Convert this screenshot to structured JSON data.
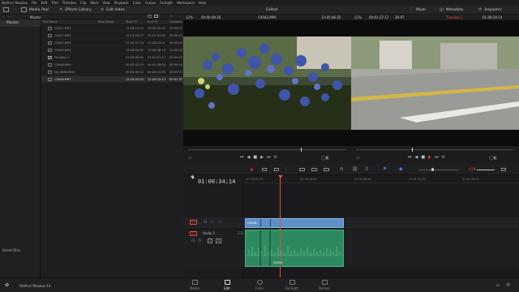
{
  "menu": [
    "DaVinci Resolve",
    "File",
    "Edit",
    "Trim",
    "Timeline",
    "Clip",
    "Mark",
    "View",
    "Playback",
    "Color",
    "Fusion",
    "Fairlight",
    "Workspace",
    "Help"
  ],
  "toolbar": {
    "media_pool": "Media Pool",
    "effects_library": "Effects Library",
    "edit_index": "Edit Index",
    "project_name": "Edited",
    "mixer": "Mixer",
    "metadata": "Metadata",
    "inspector": "Inspector"
  },
  "media_pool": {
    "bin_label": "Master",
    "master_bin": "Master",
    "smart_bins": "Smart Bins",
    "columns": [
      "File Name",
      "Reel Name",
      "Start TC",
      "End TC",
      "Duration"
    ],
    "rows": [
      {
        "name": "C0012.MP4",
        "start": "13:45:19:10",
        "end": "13:45:32:05",
        "dur": "00:00:12"
      },
      {
        "name": "C0027.MP4",
        "start": "12:12:23:17",
        "end": "12:12:37:02",
        "dur": "00:00:13"
      },
      {
        "name": "C0022.MP4",
        "start": "12:32:57:24",
        "end": "12:33:13:11",
        "dur": "00:00:15"
      },
      {
        "name": "C0043.MP4",
        "start": "13:06:20:02",
        "end": "13:06:38:14",
        "dur": "00:00:18"
      },
      {
        "name": "Timeline 1",
        "start": "01:00:00:00",
        "end": "01:01:07:17",
        "dur": "00:01:07"
      },
      {
        "name": "C0008.MP4",
        "start": "00:02:41:19",
        "end": "00:02:58:04",
        "dur": "00:00:16"
      },
      {
        "name": "DJI_0066.MOV",
        "start": "00:00:00:00",
        "end": "00:00:21:06",
        "dur": "00:00:21"
      },
      {
        "name": "C0008.MP4",
        "start": "12:18:55:04",
        "end": "12:20:32:12",
        "dur": "00:01:37"
      }
    ]
  },
  "source_viewer": {
    "zoom": "32%",
    "timecode": "00:00:09:26",
    "clip": "C0043.MP4",
    "tc_right": "13:05:46:25"
  },
  "timeline_viewer": {
    "zoom": "32%",
    "timecode": "00:01:37:17",
    "fps": "29.97",
    "timeline_name": "Timeline 1",
    "tc_right": "01:00:34:14"
  },
  "timeline": {
    "timecode": "01:00:34;14",
    "ruler": [
      "01:00:00;00",
      "01:00:24;00",
      "01:00:48;00",
      "01:01:12;00",
      "01:01:36;00"
    ],
    "video_track": {
      "id": "V1",
      "clip_label": "C0008..."
    },
    "audio_track": {
      "id": "A1",
      "name": "Audio 1",
      "level": "2.0",
      "clip_label": "C0008"
    }
  },
  "pages": [
    "Media",
    "Edit",
    "Color",
    "Fairlight",
    "Deliver"
  ],
  "active_page": "Edit",
  "app_name": "DaVinci Resolve 14",
  "colors": {
    "accent_red": "#e64b3b",
    "video_clip": "#5c90c7",
    "audio_clip": "#2d8a60"
  }
}
